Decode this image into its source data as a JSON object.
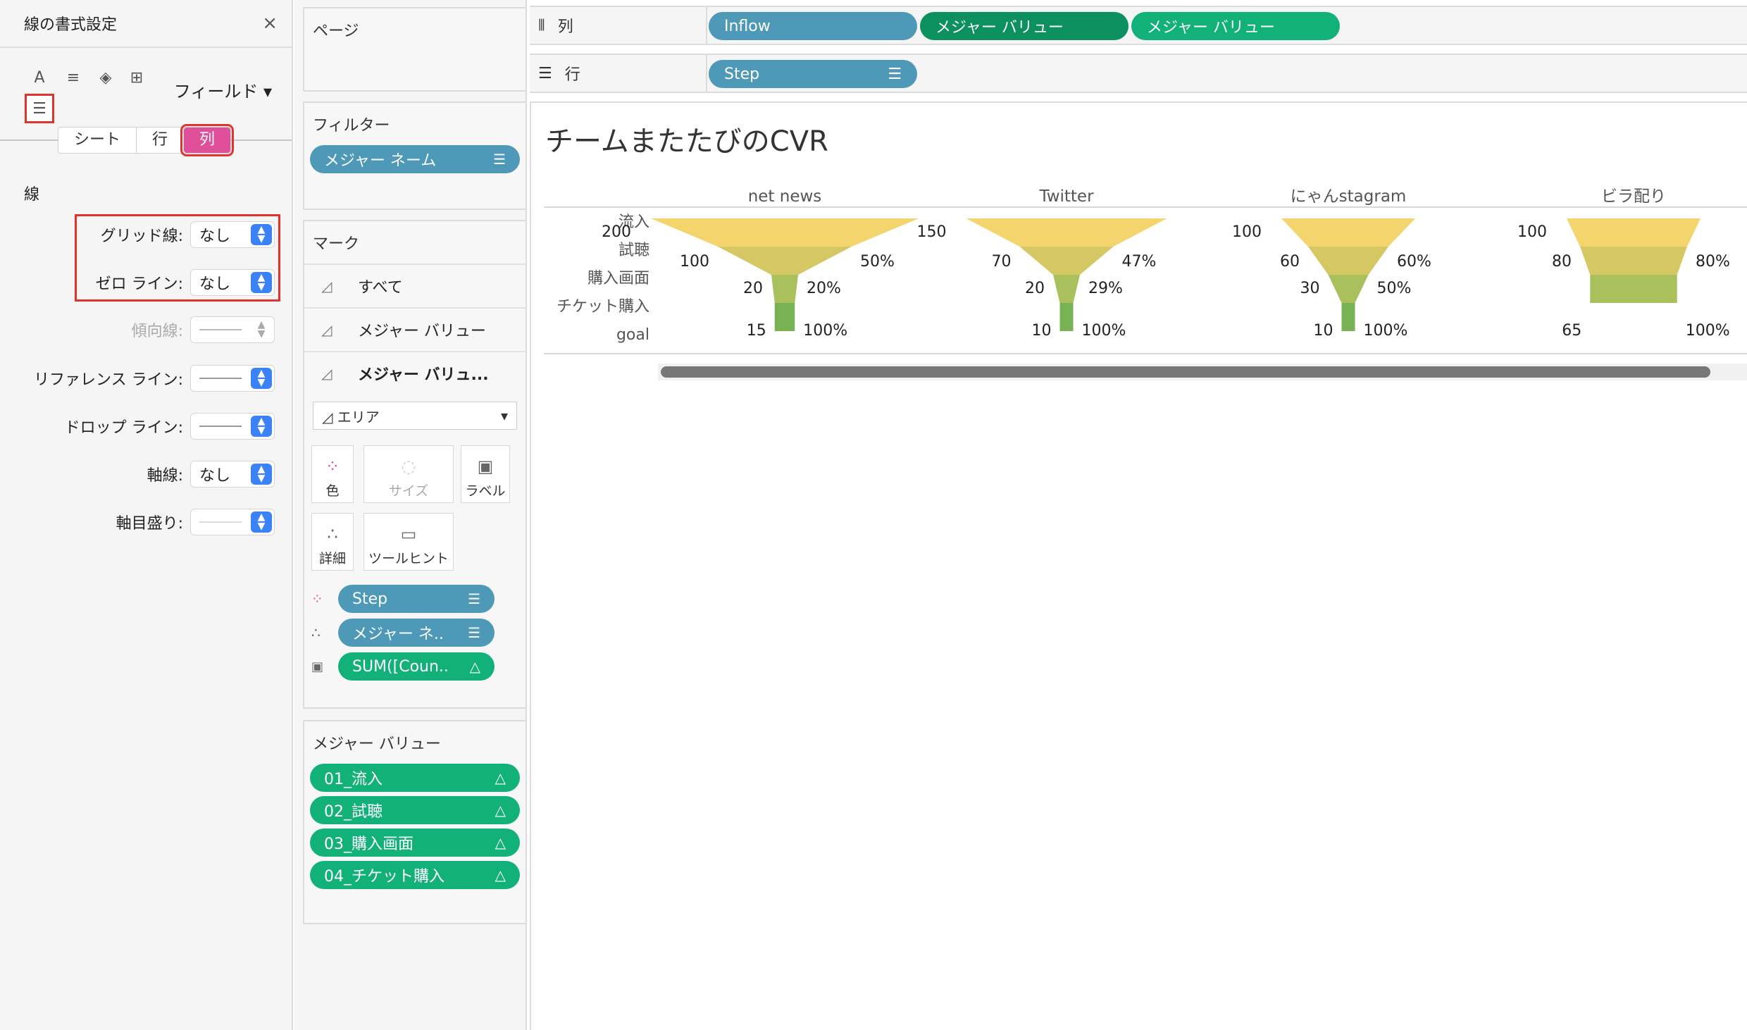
{
  "format_pane": {
    "title": "線の書式設定",
    "close": "×",
    "field_dropdown": "フィールド ▾",
    "tabs": [
      "シート",
      "行",
      "列"
    ],
    "section": "線",
    "rows": [
      {
        "label": "グリッド線:",
        "value": "なし",
        "kind": "text"
      },
      {
        "label": "ゼロ ライン:",
        "value": "なし",
        "kind": "text"
      },
      {
        "label": "傾向線:",
        "value": "",
        "kind": "line-disabled"
      },
      {
        "label": "リファレンス ライン:",
        "value": "",
        "kind": "line"
      },
      {
        "label": "ドロップ ライン:",
        "value": "",
        "kind": "line"
      },
      {
        "label": "軸線:",
        "value": "なし",
        "kind": "text"
      },
      {
        "label": "軸目盛り:",
        "value": "",
        "kind": "line-light"
      }
    ]
  },
  "cards": {
    "pages": "ページ",
    "filters": {
      "title": "フィルター",
      "pill": "メジャー ネーム"
    },
    "marks": {
      "title": "マーク",
      "rows": [
        "すべて",
        "メジャー バリュー",
        "メジャー バリュ..."
      ],
      "mark_type": "エリア",
      "buttons": {
        "color": "色",
        "size": "サイズ",
        "label": "ラベル",
        "detail": "詳細",
        "tooltip": "ツールヒント"
      },
      "fields": [
        "Step",
        "メジャー ネ..",
        "SUM([Coun.."
      ]
    },
    "measure_values": {
      "title": "メジャー バリュー",
      "items": [
        "01_流入",
        "02_試聴",
        "03_購入画面",
        "04_チケット購入"
      ]
    }
  },
  "shelves": {
    "columns": {
      "label": "列",
      "pills": [
        "Inflow",
        "メジャー バリュー",
        "メジャー バリュー"
      ]
    },
    "rows": {
      "label": "行",
      "pills": [
        "Step"
      ]
    }
  },
  "view": {
    "title": "チームまたたびのCVR"
  },
  "chart_data": {
    "type": "area",
    "title": "チームまたたびのCVR",
    "row_labels": [
      "流入",
      "試聴",
      "購入画面",
      "チケット購入",
      "goal"
    ],
    "band_colors": [
      "#f3d46d",
      "#d5c864",
      "#a9c05d",
      "#79b254",
      "#4a9e46"
    ],
    "panels": [
      {
        "name": "net news",
        "values": [
          200,
          100,
          20,
          15
        ],
        "pct": [
          "50%",
          "20%",
          "100%"
        ]
      },
      {
        "name": "Twitter",
        "values": [
          150,
          70,
          20,
          10
        ],
        "pct": [
          "47%",
          "29%",
          "100%"
        ]
      },
      {
        "name": "にゃんstagram",
        "values": [
          100,
          60,
          30,
          10
        ],
        "pct": [
          "60%",
          "50%",
          "100%"
        ]
      },
      {
        "name": "ビラ配り",
        "values": [
          100,
          80,
          65
        ],
        "pct": [
          "80%",
          "100%"
        ]
      }
    ]
  }
}
